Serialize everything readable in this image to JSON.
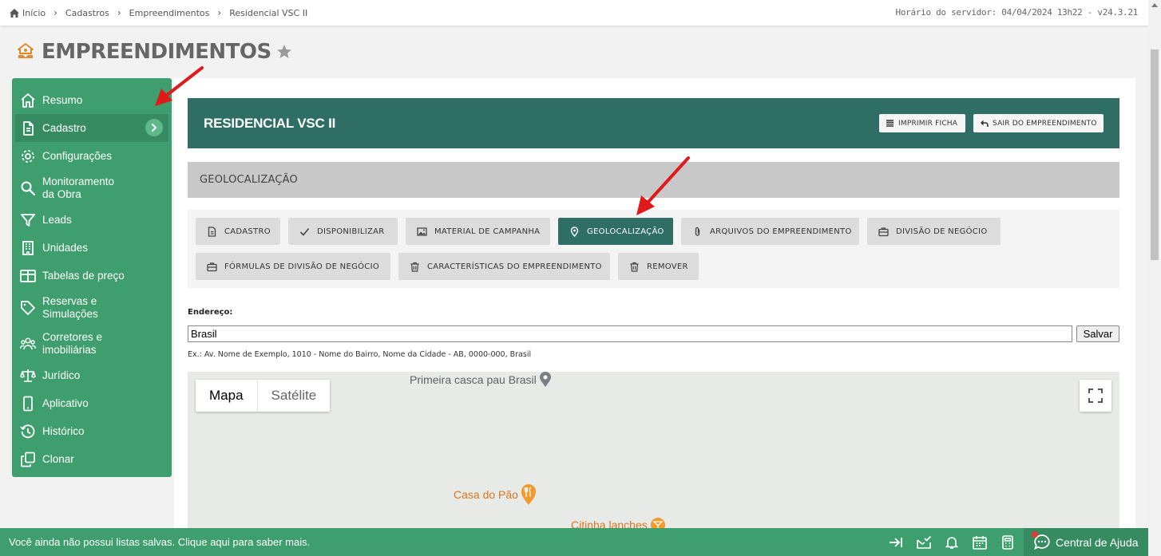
{
  "breadcrumb": {
    "items": [
      "Início",
      "Cadastros",
      "Empreendimentos",
      "Residencial VSC II"
    ]
  },
  "server_time": "Horário do servidor: 04/04/2024 13h22 - v24.3.21",
  "page_title": "EMPREENDIMENTOS",
  "sidebar": {
    "items": [
      {
        "label": "Resumo",
        "icon": "home-icon"
      },
      {
        "label": "Cadastro",
        "icon": "document-icon"
      },
      {
        "label": "Configurações",
        "icon": "gear-icon"
      },
      {
        "label": "Monitoramento da Obra",
        "line1": "Monitoramento",
        "line2": "da Obra",
        "icon": "search-icon"
      },
      {
        "label": "Leads",
        "icon": "filter-icon"
      },
      {
        "label": "Unidades",
        "icon": "building-icon"
      },
      {
        "label": "Tabelas de preço",
        "icon": "table-icon"
      },
      {
        "label": "Reservas e Simulações",
        "line1": "Reservas e",
        "line2": "Simulações",
        "icon": "tag-icon"
      },
      {
        "label": "Corretores e imobiliárias",
        "line1": "Corretores e",
        "line2": "imobiliárias",
        "icon": "people-icon"
      },
      {
        "label": "Jurídico",
        "icon": "scale-icon"
      },
      {
        "label": "Aplicativo",
        "icon": "phone-icon"
      },
      {
        "label": "Histórico",
        "icon": "history-icon"
      },
      {
        "label": "Clonar",
        "icon": "copy-icon"
      }
    ]
  },
  "header": {
    "title": "RESIDENCIAL VSC II",
    "print_label": "IMPRIMIR FICHA",
    "exit_label": "SAIR DO EMPREENDIMENTO"
  },
  "section_title": "GEOLOCALIZAÇÃO",
  "tabs": [
    {
      "label": "CADASTRO",
      "icon": "document-icon"
    },
    {
      "label": "DISPONIBILIZAR",
      "icon": "check-icon"
    },
    {
      "label": "MATERIAL DE CAMPANHA",
      "icon": "image-icon"
    },
    {
      "label": "GEOLOCALIZAÇÃO",
      "icon": "pin-icon"
    },
    {
      "label": "ARQUIVOS DO EMPREENDIMENTO",
      "icon": "paperclip-icon"
    },
    {
      "label": "DIVISÃO DE NEGÓCIO",
      "icon": "briefcase-icon"
    },
    {
      "label": "FÓRMULAS DE DIVISÃO DE NEGÓCIO",
      "icon": "briefcase-icon"
    },
    {
      "label": "CARACTERÍSTICAS DO EMPREENDIMENTO",
      "icon": "trash-icon"
    },
    {
      "label": "REMOVER",
      "icon": "trash-icon"
    }
  ],
  "address": {
    "label": "Endereço:",
    "value": "Brasil",
    "save_label": "Salvar",
    "hint": "Ex.: Av. Nome de Exemplo, 1010 - Nome do Bairro, Nome da Cidade - AB, 0000-000, Brasil"
  },
  "map": {
    "map_label": "Mapa",
    "satellite_label": "Satélite",
    "poi_1": "Primeira casca pau Brasil",
    "poi_2": "Casa do Pão",
    "poi_3": "Citinha lanches"
  },
  "bottom": {
    "message": "Você ainda não possui listas salvas. Clique aqui para saber mais.",
    "help_label": "Central de Ajuda"
  },
  "colors": {
    "accent": "#3f9e6e",
    "header": "#2f6e64",
    "arrow": "#e0191b"
  }
}
